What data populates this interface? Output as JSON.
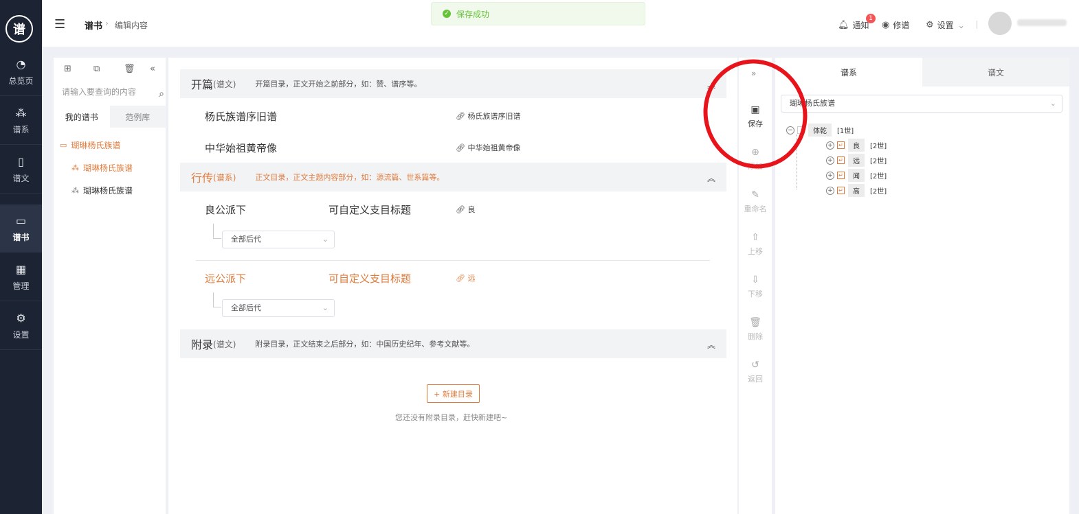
{
  "app": {
    "logo_text": "谱"
  },
  "nav": {
    "items": [
      {
        "label": "总览页",
        "icon": "pie-chart-icon"
      },
      {
        "label": "谱系",
        "icon": "network-icon"
      },
      {
        "label": "谱文",
        "icon": "document-icon"
      },
      {
        "label": "谱书",
        "icon": "book-icon",
        "active": true
      },
      {
        "label": "管理",
        "icon": "grid-icon"
      },
      {
        "label": "设置",
        "icon": "gear-icon"
      }
    ]
  },
  "header": {
    "breadcrumb": [
      "谱书",
      "编辑内容"
    ],
    "toast": "保存成功",
    "notify_label": "通知",
    "notify_count": "1",
    "revise_label": "修谱",
    "settings_label": "设置"
  },
  "left_panel": {
    "search_placeholder": "请输入要查询的内容",
    "tabs": [
      "我的谱书",
      "范例库"
    ],
    "folder": "瑚琳杨氏族谱",
    "items": [
      "瑚琳杨氏族谱",
      "瑚琳杨氏族谱"
    ]
  },
  "main": {
    "sections": [
      {
        "title": "开篇",
        "sub": "(谱文)",
        "desc": "开篇目录，正文开始之前部分，如：赞、谱序等。"
      },
      {
        "title": "行传",
        "sub": "(谱系)",
        "desc": "正文目录，正文主题内容部分，如：源流篇、世系篇等。"
      },
      {
        "title": "附录",
        "sub": "(谱文)",
        "desc": "附录目录，正文结束之后部分，如：中国历史纪年、参考文献等。"
      }
    ],
    "opening_items": [
      {
        "title": "杨氏族谱序旧谱",
        "link": "杨氏族谱序旧谱"
      },
      {
        "title": "中华始祖黄帝像",
        "link": "中华始祖黄帝像"
      }
    ],
    "branch_items": [
      {
        "title": "良公派下",
        "custom": "可自定义支目标题",
        "link": "良",
        "select": "全部后代"
      },
      {
        "title": "远公派下",
        "custom": "可自定义支目标题",
        "link": "远",
        "select": "全部后代"
      }
    ],
    "new_button": "+ 新建目录",
    "empty_hint": "您还没有附录目录，赶快新建吧~"
  },
  "actions": [
    "保存",
    "添加",
    "重命名",
    "上移",
    "下移",
    "删除",
    "返回"
  ],
  "right_panel": {
    "tabs": [
      "谱系",
      "谱文"
    ],
    "selected_book": "瑚琳杨氏族谱",
    "root": {
      "name": "体乾",
      "gen": "[1世]"
    },
    "children": [
      {
        "name": "良",
        "gen": "[2世]"
      },
      {
        "name": "远",
        "gen": "[2世]"
      },
      {
        "name": "闻",
        "gen": "[2世]"
      },
      {
        "name": "高",
        "gen": "[2世]"
      }
    ]
  },
  "colors": {
    "accent": "#e07b3c",
    "nav_bg": "#1c2333",
    "success": "#67c23a",
    "annotation": "#e8141c"
  }
}
